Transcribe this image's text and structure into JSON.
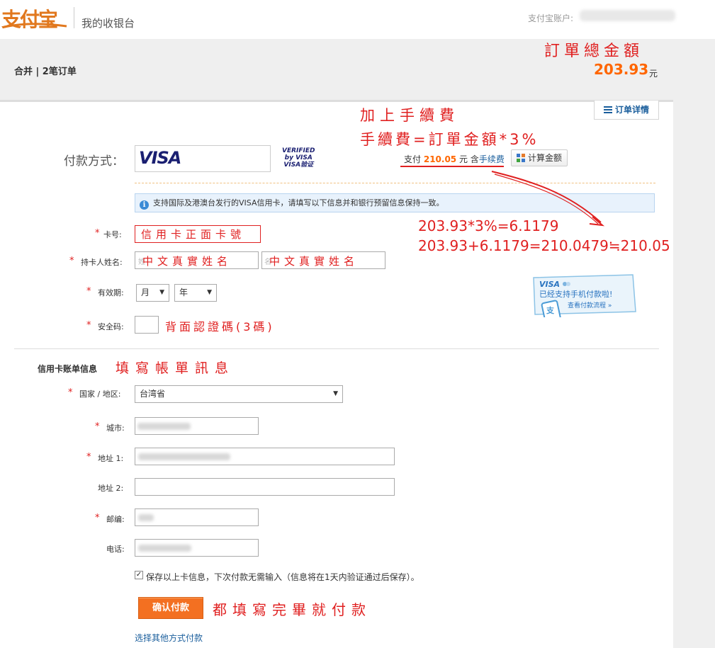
{
  "header": {
    "logo_text": "支付宝",
    "site_title": "我的收银台",
    "account_label": "支付宝账户:"
  },
  "order": {
    "summary": "合并 | 2笔订单",
    "total_amount": "203.93",
    "total_unit": "元",
    "detail_tab": "订单详情"
  },
  "payment": {
    "method_label": "付款方式：",
    "card_brand": "VISA",
    "verified_line1": "VERIFIED",
    "verified_line2": "by VISA",
    "verified_line3": "VISA验证",
    "pay_prefix": "支付",
    "pay_amount": "210.05",
    "pay_suffix": "元 含",
    "fee_link": "手续费",
    "calc_button": "计算金额",
    "info_icon": "info-icon",
    "info_text": "支持国际及港澳台发行的VISA信用卡，请填写以下信息并和银行预留信息保持一致。"
  },
  "card_form": {
    "card_number_label": "卡号:",
    "holder_name_label": "持卡人姓名:",
    "holder_first_placeholder": "姓",
    "holder_last_placeholder": "名",
    "expiry_label": "有效期:",
    "month_value": "月",
    "year_value": "年",
    "cvv_label": "安全码:"
  },
  "billing": {
    "title": "信用卡账单信息",
    "country_label": "国家 / 地区:",
    "country_value": "台湾省",
    "city_label": "城市:",
    "address1_label": "地址 1:",
    "address2_label": "地址 2:",
    "zip_label": "邮编:",
    "phone_label": "电话:"
  },
  "save_option": {
    "checked": true,
    "text": "保存以上卡信息，下次付款无需输入（信息将在1天内验证通过后保存）。"
  },
  "actions": {
    "confirm_button": "确认付款",
    "other_method_link": "选择其他方式付款"
  },
  "mobile_banner": {
    "brand": "VISA",
    "line1": "已经支持手机付款啦!",
    "line2": "查看付款流程 »"
  },
  "annotations": {
    "total_title": "訂單總金額",
    "fee_line1": "加上手續費",
    "fee_line2": "手續費=訂單金額*3%",
    "calc_line1": "203.93*3%=6.1179",
    "calc_line2": "203.93+6.1179=210.0479≒210.05",
    "card_number": "信用卡正面卡號",
    "name1": "中文真實姓名",
    "name2": "中文真實姓名",
    "cvv": "背面認證碼(3碼)",
    "billing": "填寫帳單訊息",
    "pay": "都填寫完畢就付款"
  },
  "colors": {
    "brand_orange": "#ff6600",
    "annotation_red": "#e02020",
    "link_blue": "#1a5e9c"
  }
}
